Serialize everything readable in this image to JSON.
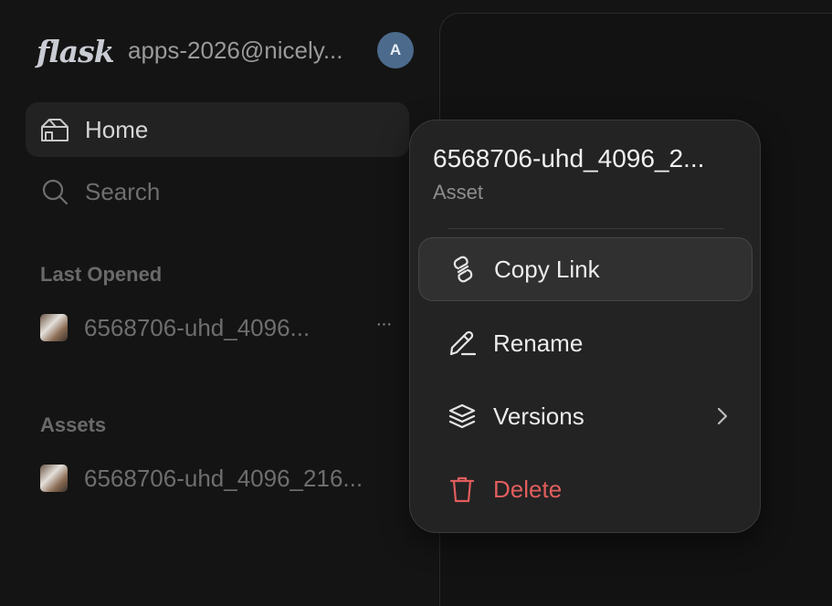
{
  "header": {
    "logo": "flask",
    "account": "apps-2026@nicely...",
    "avatar_initial": "A"
  },
  "nav": {
    "home_label": "Home",
    "search_label": "Search"
  },
  "sections": {
    "last_opened_title": "Last Opened",
    "last_opened_file": "6568706-uhd_4096...",
    "more_label": "···",
    "assets_title": "Assets",
    "assets_file": "6568706-uhd_4096_216..."
  },
  "context_menu": {
    "title": "6568706-uhd_4096_2...",
    "subtitle": "Asset",
    "items": [
      {
        "label": "Copy Link",
        "icon": "link-icon"
      },
      {
        "label": "Rename",
        "icon": "pencil-icon"
      },
      {
        "label": "Versions",
        "icon": "layers-icon"
      },
      {
        "label": "Delete",
        "icon": "trash-icon"
      }
    ]
  },
  "colors": {
    "background": "#141414",
    "menu_background": "#232323",
    "delete": "#e15d5d",
    "avatar": "#4c6b8c"
  }
}
